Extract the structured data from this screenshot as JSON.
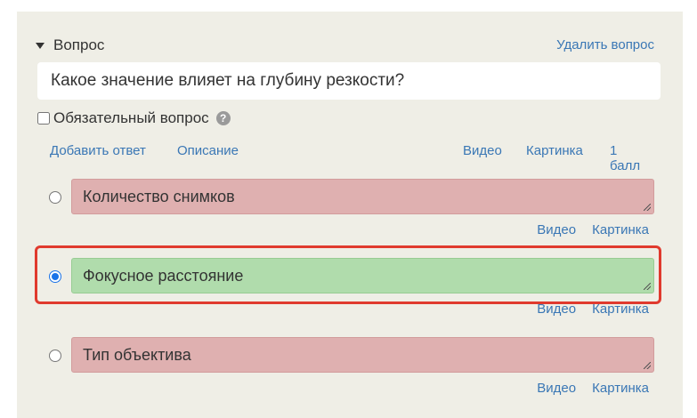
{
  "question": {
    "header_label": "Вопрос",
    "delete_label": "Удалить вопрос",
    "text": "Какое значение влияет на глубину резкости?",
    "required_label": "Обязательный вопрос",
    "help_icon_glyph": "?"
  },
  "actions": {
    "add_answer": "Добавить ответ",
    "description": "Описание",
    "video": "Видео",
    "picture": "Картинка",
    "points": "1 балл"
  },
  "answers": [
    {
      "text": "Количество снимков",
      "video": "Видео",
      "picture": "Картинка",
      "selected": false,
      "correct": false
    },
    {
      "text": "Фокусное расстояние",
      "video": "Видео",
      "picture": "Картинка",
      "selected": true,
      "correct": true
    },
    {
      "text": "Тип объектива",
      "video": "Видео",
      "picture": "Картинка",
      "selected": false,
      "correct": false
    }
  ],
  "colors": {
    "link": "#3a77b5",
    "wrong_answer_bg": "#dfb0b0",
    "correct_answer_bg": "#b0dcac",
    "highlight": "#e03a2e",
    "panel_bg": "#efeee6"
  }
}
